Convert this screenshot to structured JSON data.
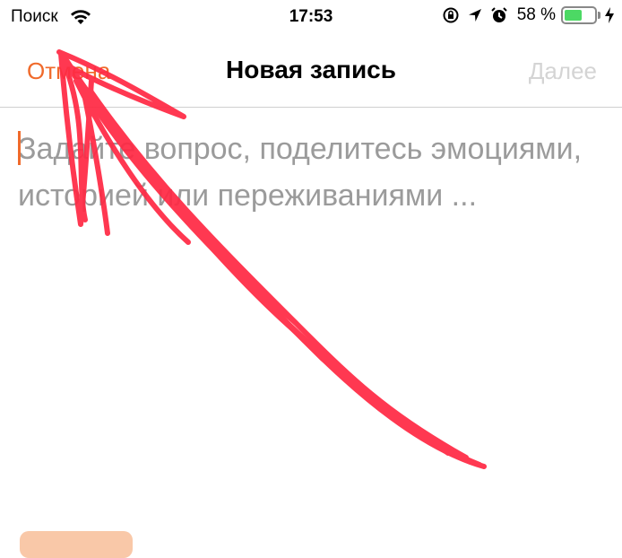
{
  "status_bar": {
    "carrier": "Поиск",
    "time": "17:53",
    "battery_percent": "58 %",
    "battery_level": 0.58
  },
  "nav": {
    "cancel_label": "Отмена",
    "title": "Новая запись",
    "next_label": "Далее"
  },
  "editor": {
    "placeholder": "Задайте вопрос, поделитесь эмоциями, историей или переживаниями ..."
  },
  "colors": {
    "accent": "#f06a2b",
    "disabled": "#d4d4d4",
    "placeholder": "#9b9b9b",
    "annotation": "#ff2a44"
  }
}
